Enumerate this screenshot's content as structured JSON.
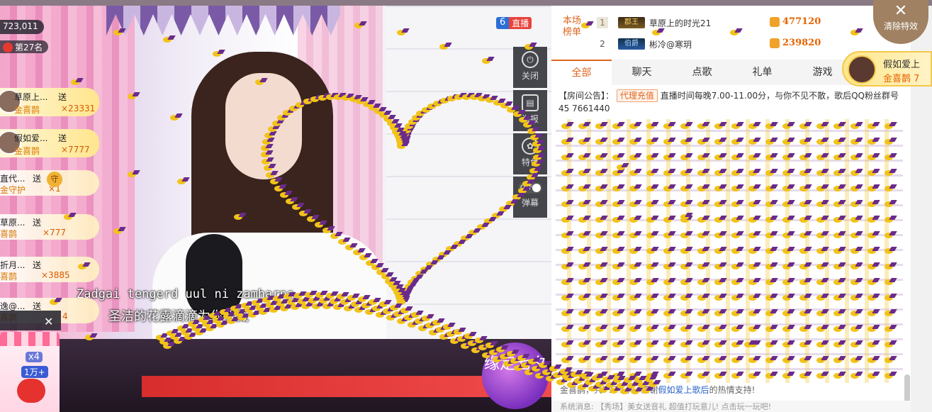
{
  "stream": {
    "viewer_count": "723,011",
    "rank": "第27名",
    "live_badge_number": "6",
    "live_badge_text": "直播",
    "lyric_line_1": "Zadgai tengerd uul ni zamharna",
    "lyric_line_2": "圣洁的花露滴滴为你收藏",
    "qixi_label": "缘定七夕"
  },
  "gift_feed": [
    {
      "name": "草原上...",
      "send": "送",
      "gift": "金喜鹊",
      "count": "×23331"
    },
    {
      "name": "假如爱...",
      "send": "送",
      "gift": "金喜鹊",
      "count": "×7777"
    },
    {
      "name": "直代...",
      "send": "送",
      "gift": "金守护",
      "count": "×1",
      "guard": "守"
    },
    {
      "name": "草原...",
      "send": "送",
      "gift": "喜鹊",
      "count": "×777"
    },
    {
      "name": "折月...",
      "send": "送",
      "gift": "喜鹊",
      "count": "×3885"
    },
    {
      "name": "逸@...",
      "send": "送",
      "gift": "喜鹊",
      "count": "4"
    }
  ],
  "mini_popup": {
    "multiplier": "x4",
    "amount": "1万+"
  },
  "tools": [
    {
      "label": "关闭",
      "icon": "power-icon"
    },
    {
      "label": "海报",
      "icon": "poster-icon"
    },
    {
      "label": "特色",
      "icon": "feature-icon"
    },
    {
      "label": "弹幕",
      "icon": "danmaku-icon",
      "toggle": "OFF"
    }
  ],
  "ranking": {
    "label": "本场榜单",
    "rows": [
      {
        "num": "1",
        "level": "郡王",
        "name": "草原上的时光21",
        "score": "477120"
      },
      {
        "num": "2",
        "level": "伯爵",
        "name": "彬冷@寒玥",
        "score": "239820"
      }
    ]
  },
  "tabs": [
    "全部",
    "聊天",
    "点歌",
    "礼单",
    "游戏"
  ],
  "notice": {
    "prefix": "【房间公告】：",
    "tag": "代理充值",
    "text": "直播时间每晚7.00-11.00分，与你不见不散，歌后QQ粉丝群号45",
    "text2": "7661440"
  },
  "thanks": {
    "before": "金喜鹊，共7777个，感谢",
    "user": "假如爱上歌后",
    "after": "的热情支持!"
  },
  "system_message": "系统消息: 【秀场】美女送音礼 超值打玩意儿! 点击玩一玩吧!",
  "fan_card": {
    "name": "假如爱上",
    "gift": "金喜鹊 7"
  },
  "clear_effects": "清除特效",
  "colors": {
    "accent": "#e0661f",
    "gold": "#f2c318",
    "purple": "#6a2b8c"
  }
}
